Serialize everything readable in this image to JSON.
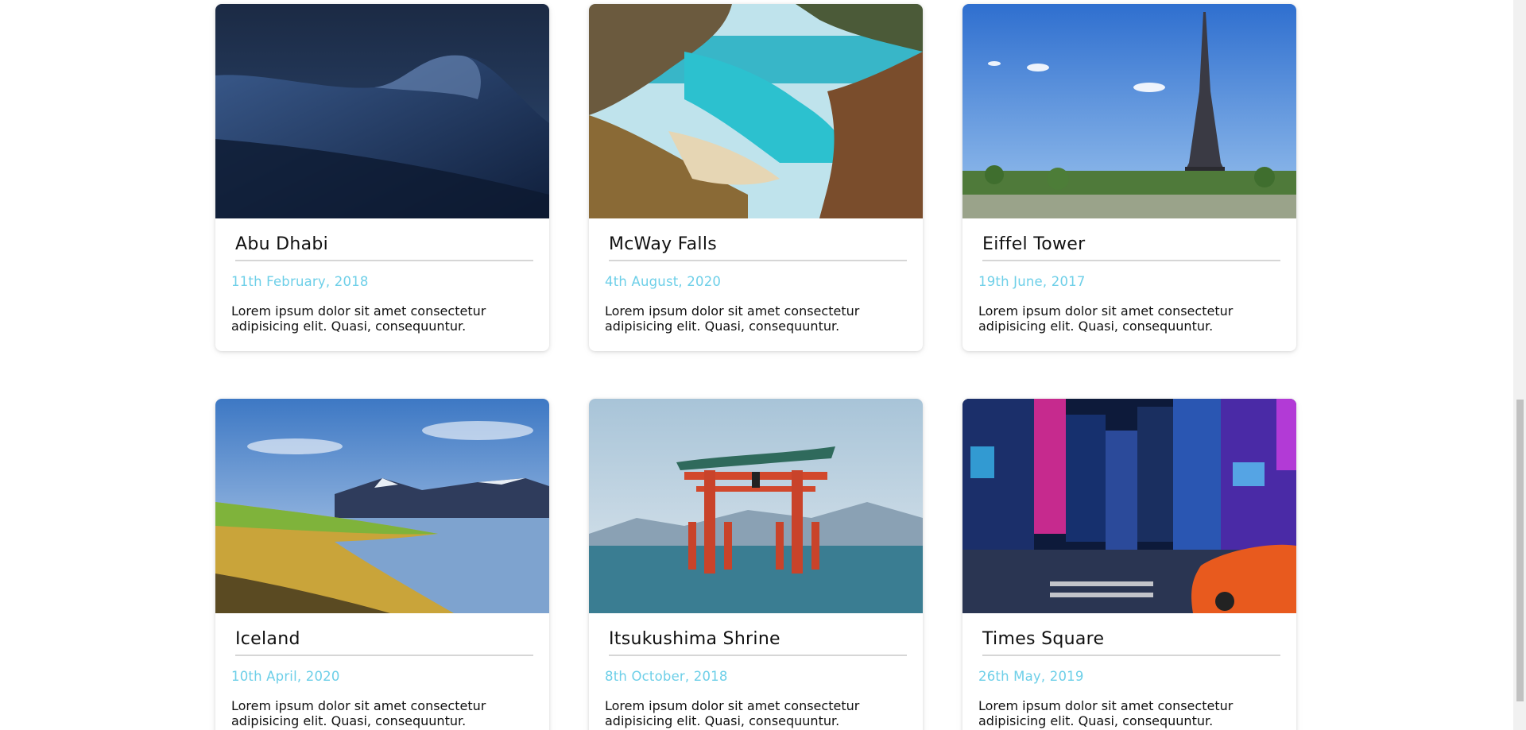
{
  "cards": [
    {
      "title": "Abu Dhabi",
      "date": "11th February, 2018",
      "text": "Lorem ipsum dolor sit amet consectetur adipisicing elit. Quasi, consequuntur.",
      "image": "desert-dunes-night"
    },
    {
      "title": "McWay Falls",
      "date": "4th August, 2020",
      "text": "Lorem ipsum dolor sit amet consectetur adipisicing elit. Quasi, consequuntur.",
      "image": "coastal-cove-turquoise"
    },
    {
      "title": "Eiffel Tower",
      "date": "19th June, 2017",
      "text": "Lorem ipsum dolor sit amet consectetur adipisicing elit. Quasi, consequuntur.",
      "image": "eiffel-tower-blue-sky"
    },
    {
      "title": "Iceland",
      "date": "10th April, 2020",
      "text": "Lorem ipsum dolor sit amet consectetur adipisicing elit. Quasi, consequuntur.",
      "image": "fjord-mountains"
    },
    {
      "title": "Itsukushima Shrine",
      "date": "8th October, 2018",
      "text": "Lorem ipsum dolor sit amet consectetur adipisicing elit. Quasi, consequuntur.",
      "image": "torii-gate-water"
    },
    {
      "title": "Times Square",
      "date": "26th May, 2019",
      "text": "Lorem ipsum dolor sit amet consectetur adipisicing elit. Quasi, consequuntur.",
      "image": "city-street-neon-night"
    }
  ],
  "colors": {
    "date": "#6dcfe8",
    "title": "#111111",
    "divider": "#d6d6d6"
  }
}
